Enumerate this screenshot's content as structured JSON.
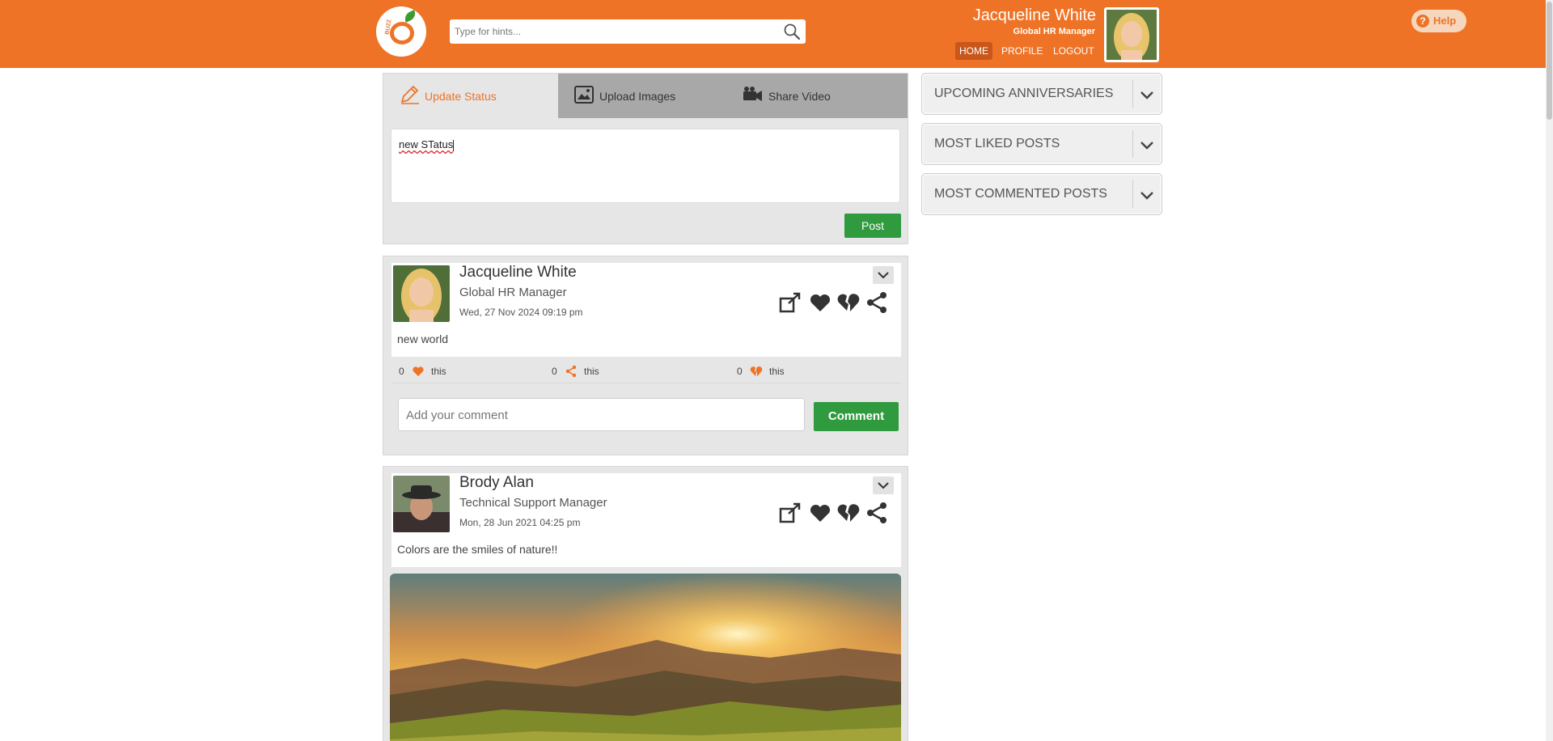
{
  "header": {
    "logo_text": "BUZZ",
    "search_placeholder": "Type for hints...",
    "user_name": "Jacqueline White",
    "user_role": "Global HR Manager",
    "nav": [
      "HOME",
      "PROFILE",
      "LOGOUT"
    ],
    "active_nav": "HOME",
    "help_label": "Help",
    "accent_color": "#ee7326"
  },
  "composer": {
    "tabs": [
      "Update Status",
      "Upload Images",
      "Share Video"
    ],
    "active_tab": "Update Status",
    "status_value": "new STatus",
    "post_button": "Post"
  },
  "posts": [
    {
      "author": "Jacqueline White",
      "role": "Global HR Manager",
      "date": "Wed, 27 Nov 2024  09:19 pm",
      "text": "new world",
      "likes": "0",
      "shares": "0",
      "dislikes": "0",
      "stat_suffix": "this",
      "comment_placeholder": "Add your comment",
      "comment_button": "Comment"
    },
    {
      "author": "Brody Alan",
      "role": "Technical Support Manager",
      "date": "Mon, 28 Jun 2021  04:25 pm",
      "text": "Colors are the smiles of nature!!"
    }
  ],
  "sidebar": {
    "widgets": [
      "UPCOMING ANNIVERSARIES",
      "MOST LIKED POSTS",
      "MOST COMMENTED POSTS"
    ]
  },
  "icons": {
    "search": "search-icon",
    "edit": "pencil-icon",
    "image": "image-icon",
    "video": "video-camera-icon",
    "share_out": "share-out-icon",
    "like": "heart-icon",
    "dislike": "broken-heart-icon",
    "share": "share-icon",
    "chevron": "chevron-down-icon"
  },
  "colors": {
    "button_green": "#2f9a3e",
    "stat_icon": "#ee7326"
  }
}
